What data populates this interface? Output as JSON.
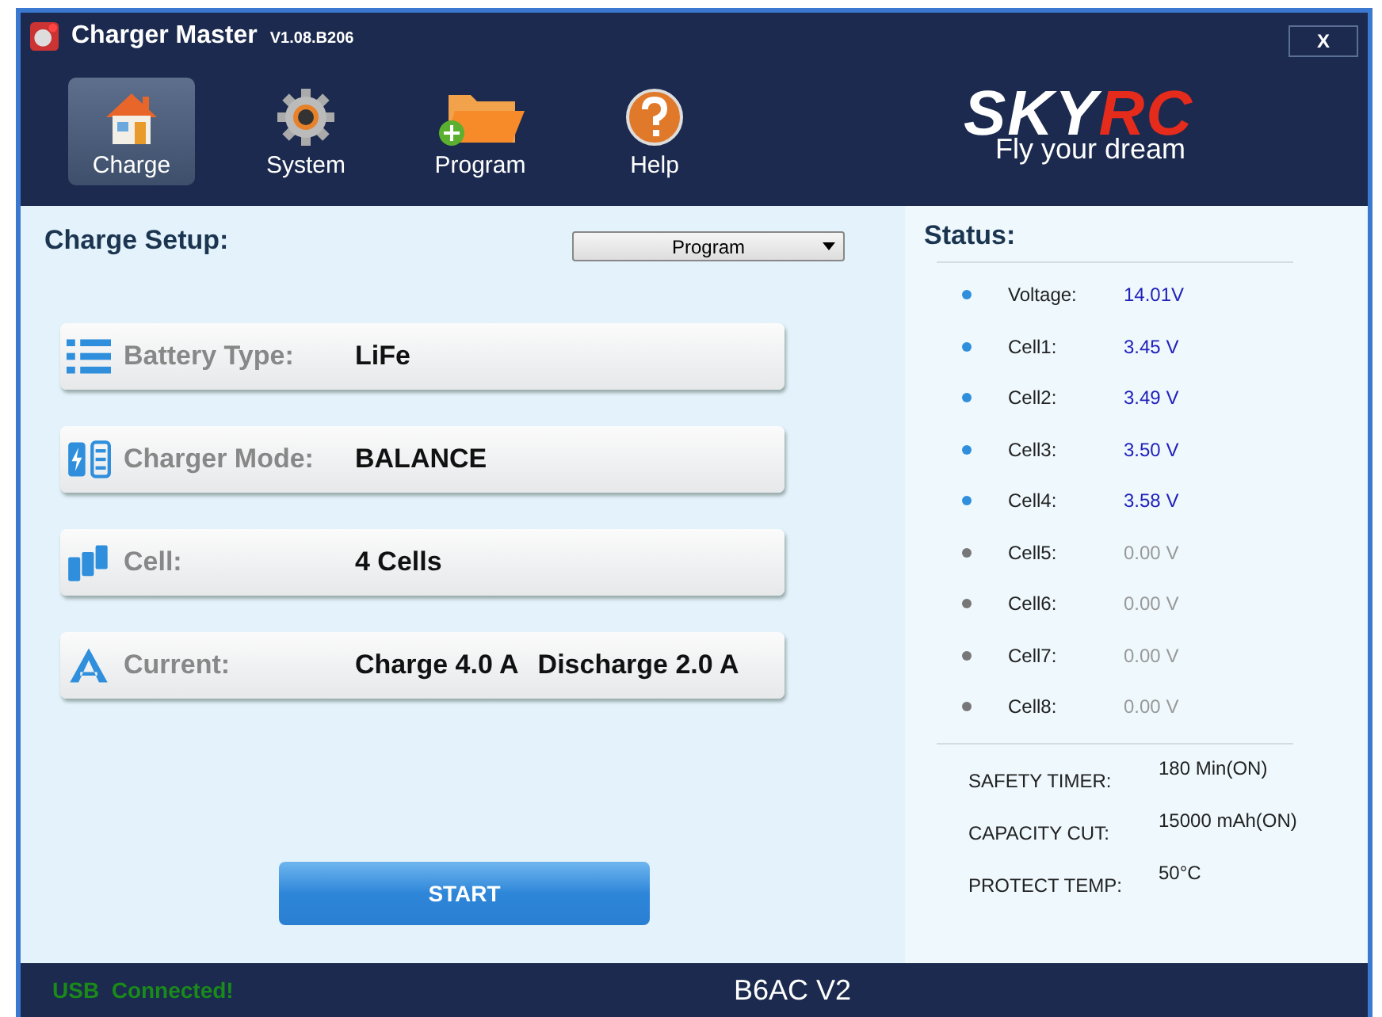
{
  "window": {
    "title": "Charger Master",
    "version": "V1.08.B206",
    "close": "X"
  },
  "nav": [
    {
      "kind": "house",
      "label": "Charge",
      "selected": true
    },
    {
      "kind": "gear",
      "label": "System",
      "selected": false
    },
    {
      "kind": "folder",
      "label": "Program",
      "selected": false
    },
    {
      "kind": "help",
      "label": "Help",
      "selected": false
    }
  ],
  "logo": {
    "primary": "SKY",
    "accent": "RC",
    "tagline": "Fly your dream"
  },
  "setup": {
    "title": "Charge Setup:",
    "dropdown": "Program",
    "rows": [
      {
        "kind": "list",
        "label": "Battery Type:",
        "value": "LiFe"
      },
      {
        "kind": "battery",
        "label": "Charger Mode:",
        "value": "BALANCE"
      },
      {
        "kind": "cells",
        "label": "Cell:",
        "value": "4 Cells"
      },
      {
        "kind": "current",
        "label": "Current:",
        "value": "Charge 4.0 A",
        "value_2": "Discharge 2.0 A"
      }
    ],
    "start": "START"
  },
  "status": {
    "title": "Status:",
    "readings": [
      {
        "label": "Voltage:",
        "value": "14.01V",
        "active": true
      },
      {
        "label": "Cell1:",
        "value": "3.45 V",
        "active": true
      },
      {
        "label": "Cell2:",
        "value": "3.49 V",
        "active": true
      },
      {
        "label": "Cell3:",
        "value": "3.50 V",
        "active": true
      },
      {
        "label": "Cell4:",
        "value": "3.58 V",
        "active": true
      },
      {
        "label": "Cell5:",
        "value": "0.00 V",
        "active": false
      },
      {
        "label": "Cell6:",
        "value": "0.00 V",
        "active": false
      },
      {
        "label": "Cell7:",
        "value": "0.00 V",
        "active": false
      },
      {
        "label": "Cell8:",
        "value": "0.00 V",
        "active": false
      }
    ],
    "settings": [
      {
        "label": "SAFETY TIMER:",
        "value": "180 Min(ON)"
      },
      {
        "label": "CAPACITY CUT:",
        "value": "15000 mAh(ON)"
      },
      {
        "label": "PROTECT TEMP:",
        "value": "50°C"
      }
    ]
  },
  "status_bar": {
    "connection": "USB  Connected!",
    "device": "B6AC V2"
  }
}
